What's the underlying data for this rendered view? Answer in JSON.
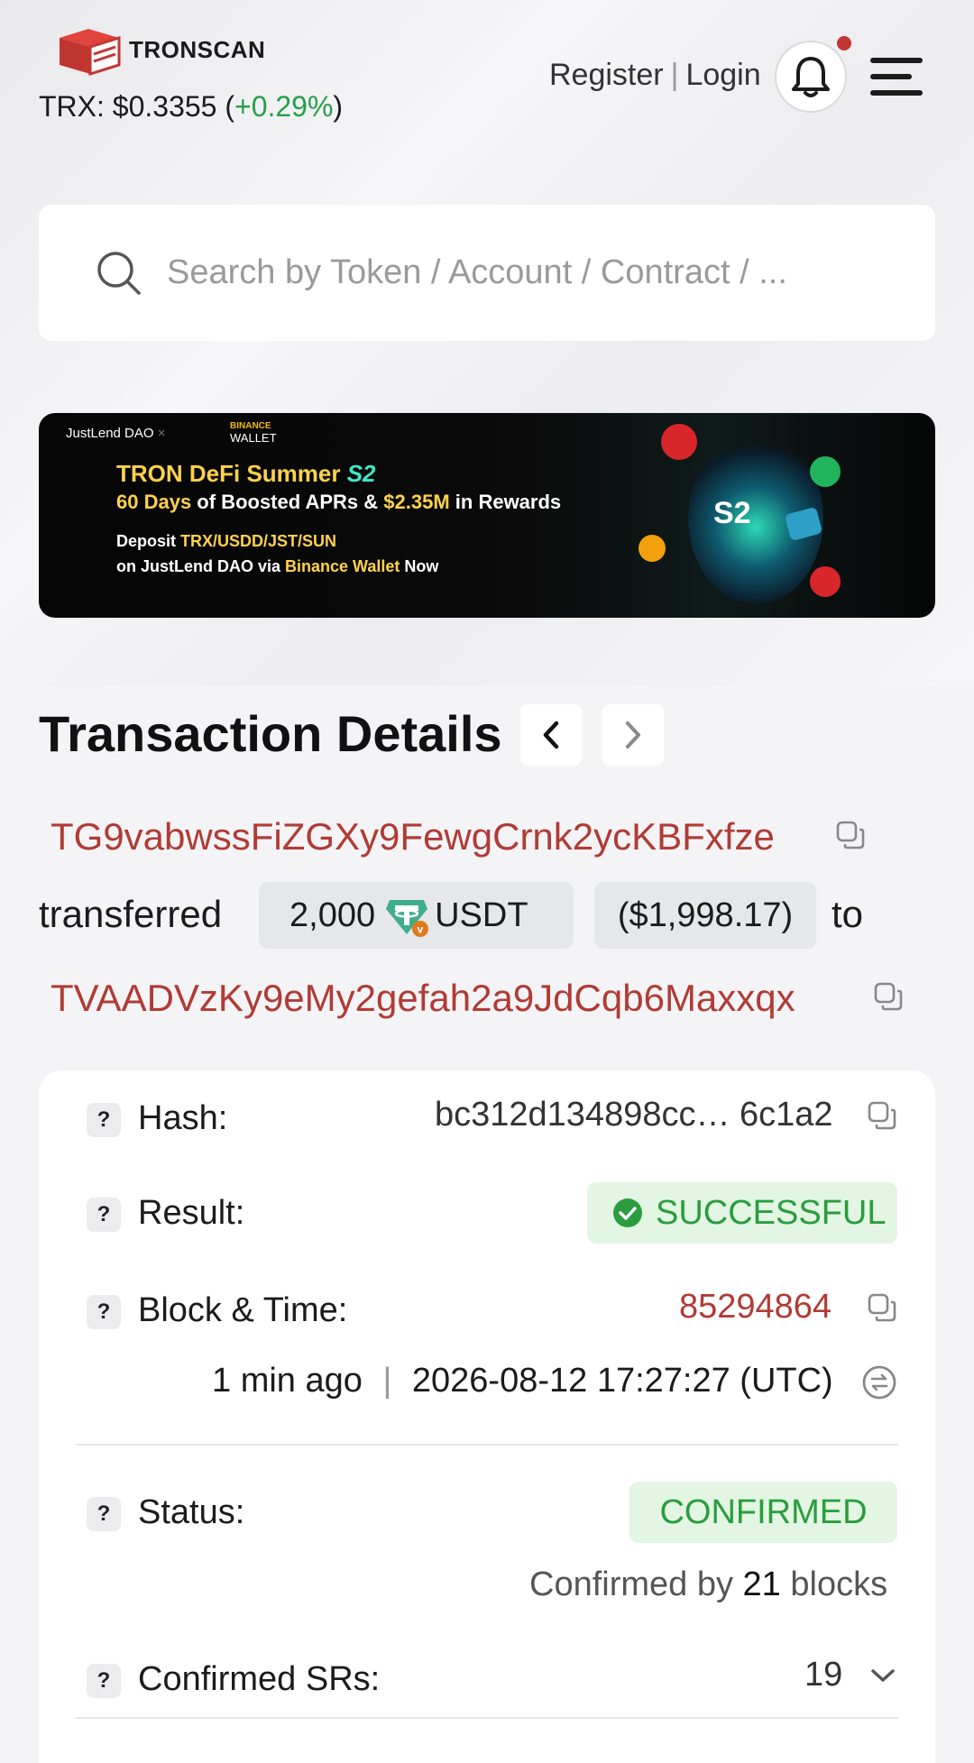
{
  "header": {
    "logo_text": "TRONSCAN",
    "price_prefix": "TRX: ",
    "price": "$0.3355",
    "change_open": " (",
    "change": "+0.29%",
    "change_close": ")",
    "register": "Register",
    "separator": "|",
    "login": "Login"
  },
  "search": {
    "placeholder": "Search by Token / Account / Contract / ..."
  },
  "banner": {
    "brand_left": "JustLend DAO",
    "brand_times": "×",
    "brand_right_top": "BINANCE",
    "brand_right_bottom": "WALLET",
    "title_main": "TRON DeFi Summer ",
    "title_s2": "S2",
    "line2_a": "60 Days",
    "line2_b": " of Boosted APRs & ",
    "line2_c": "$2.35M",
    "line2_d": " in Rewards",
    "line3_a": "Deposit ",
    "line3_b": "TRX/USDD/JST/SUN",
    "line4_a": "on JustLend DAO via ",
    "line4_b": "Binance Wallet",
    "line4_c": " Now",
    "orb_label": "S2"
  },
  "transaction": {
    "title": "Transaction Details",
    "from_address": "TG9vabwssFiZGXy9FewgCrnk2ycKBFxfze",
    "transferred_word": "transferred",
    "amount": "2,000",
    "token": "USDT",
    "usd_value": "($1,998.17)",
    "to_word": "to",
    "to_address": "TVAADVzKy9eMy2gefah2a9JdCqb6Maxxqx"
  },
  "details": {
    "hash_label": "Hash:",
    "hash_value": "bc312d134898cc… 6c1a2",
    "result_label": "Result:",
    "result_value": "SUCCESSFUL",
    "block_label": "Block & Time:",
    "block_value": "85294864",
    "time_ago": "1 min ago",
    "time_sep": "|",
    "timestamp": "2026-08-12 17:27:27 (UTC)",
    "status_label": "Status:",
    "status_value": "CONFIRMED",
    "confirmed_by_prefix": "Confirmed by ",
    "confirmed_blocks": "21",
    "confirmed_by_suffix": " blocks",
    "srs_label": "Confirmed SRs:",
    "srs_value": "19",
    "q_mark": "?"
  },
  "colors": {
    "accent_red": "#b13b35",
    "success_green": "#2a9d3f",
    "change_green": "#24a148"
  },
  "icons": [
    "logo-icon",
    "bell-icon",
    "menu-icon",
    "search-icon",
    "chevron-left-icon",
    "chevron-right-icon",
    "copy-icon",
    "tether-icon",
    "check-circle-icon",
    "timezone-switch-icon",
    "chevron-down-icon"
  ]
}
